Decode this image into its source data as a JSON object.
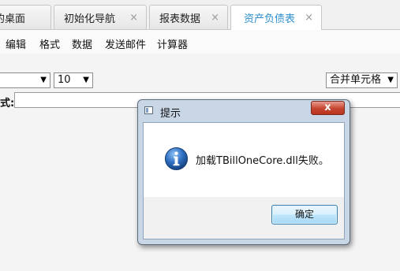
{
  "tabs": [
    {
      "label": "的桌面",
      "closable": false,
      "active": false
    },
    {
      "label": "初始化导航",
      "closable": true,
      "active": false
    },
    {
      "label": "报表数据",
      "closable": true,
      "active": false
    },
    {
      "label": "资产负债表",
      "closable": true,
      "active": true
    }
  ],
  "tab_close_glyph": "×",
  "menu": [
    "编辑",
    "格式",
    "数据",
    "发送邮件",
    "计算器"
  ],
  "toolbar": {
    "font_select_value": "",
    "size_select_value": "10",
    "merge_select_value": "合并单元格"
  },
  "formula": {
    "label": "式:",
    "value": ""
  },
  "dialog": {
    "title": "提示",
    "close_glyph": "x",
    "message": "加载TBillOneCore.dll失败。",
    "ok_label": "确定",
    "icon": "info-icon"
  },
  "colors": {
    "active_tab_text": "#2f8fd0",
    "close_button": "#c6452f"
  }
}
